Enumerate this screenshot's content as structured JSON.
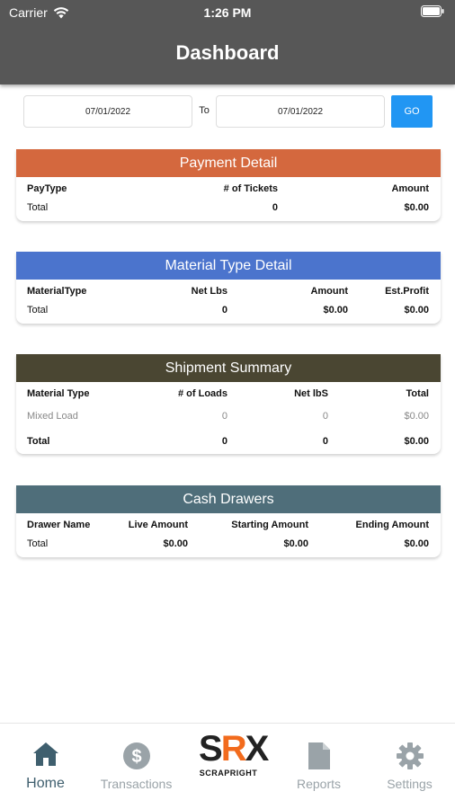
{
  "status_bar": {
    "carrier": "Carrier",
    "time": "1:26 PM"
  },
  "header": {
    "title": "Dashboard"
  },
  "date_filter": {
    "from": "07/01/2022",
    "to_label": "To",
    "to": "07/01/2022",
    "go_label": "GO"
  },
  "payment_detail": {
    "title": "Payment Detail",
    "color": "#d4683e",
    "headers": [
      "PayType",
      "# of Tickets",
      "Amount"
    ],
    "total": [
      "Total",
      "0",
      "$0.00"
    ]
  },
  "material_type_detail": {
    "title": "Material Type Detail",
    "color": "#4b74cd",
    "headers": [
      "MaterialType",
      "Net Lbs",
      "Amount",
      "Est.Profit"
    ],
    "total": [
      "Total",
      "0",
      "$0.00",
      "$0.00"
    ]
  },
  "shipment_summary": {
    "title": "Shipment Summary",
    "color": "#4a4632",
    "headers": [
      "Material Type",
      "# of Loads",
      "Net lbS",
      "Total"
    ],
    "rows": [
      [
        "Mixed Load",
        "0",
        "0",
        "$0.00"
      ]
    ],
    "total": [
      "Total",
      "0",
      "0",
      "$0.00"
    ]
  },
  "cash_drawers": {
    "title": "Cash Drawers",
    "color": "#4f6e7a",
    "headers": [
      "Drawer Name",
      "Live Amount",
      "Starting Amount",
      "Ending Amount"
    ],
    "total": [
      "Total",
      "$0.00",
      "$0.00",
      "$0.00"
    ]
  },
  "tabbar": {
    "active_color": "#3f5f6e",
    "inactive_color": "#9aa3a8",
    "tabs": [
      {
        "label": "Home",
        "icon": "home-icon"
      },
      {
        "label": "Transactions",
        "icon": "dollar-circle-icon"
      },
      {
        "label": "Reports",
        "icon": "document-icon"
      },
      {
        "label": "Settings",
        "icon": "gear-icon"
      }
    ],
    "logo": {
      "letters": "SRX",
      "subtitle": "SCRAPRIGHT"
    }
  }
}
